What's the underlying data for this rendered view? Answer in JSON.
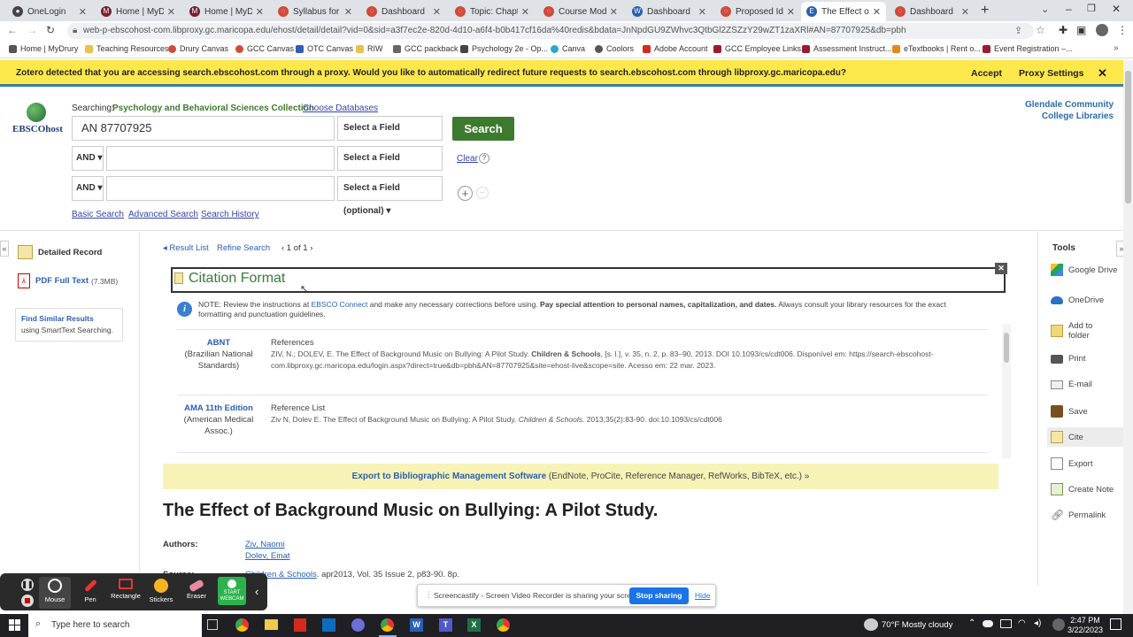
{
  "browser": {
    "tabs": [
      {
        "title": "OneLogin",
        "color": "#444"
      },
      {
        "title": "Home | MyDru",
        "color": "#7a1e2e"
      },
      {
        "title": "Home | MyDru",
        "color": "#7a1e2e"
      },
      {
        "title": "Syllabus for BS",
        "color": "#d04a3a"
      },
      {
        "title": "Dashboard",
        "color": "#d04a3a"
      },
      {
        "title": "Topic: Chapter",
        "color": "#d04a3a"
      },
      {
        "title": "Course Module",
        "color": "#d04a3a"
      },
      {
        "title": "Dashboard",
        "color": "#2b5fb3"
      },
      {
        "title": "Proposed Idea",
        "color": "#d04a3a"
      },
      {
        "title": "The Effect of Ba",
        "color": "#2b5fb3"
      },
      {
        "title": "Dashboard",
        "color": "#d04a3a"
      }
    ],
    "url": "web-p-ebscohost-com.libproxy.gc.maricopa.edu/ehost/detail/detail?vid=0&sid=a3f7ec2e-820d-4d10-a6f4-b0b417cf16da%40redis&bdata=JnNpdGU9ZWhvc3QtbGl2ZSZzY29wZT1zaXRl#AN=87707925&db=pbh",
    "bookmarks": [
      "Home | MyDrury",
      "Teaching Resources",
      "Drury Canvas",
      "GCC Canvas",
      "OTC Canvas",
      "RIW",
      "GCC packback",
      "Psychology 2e - Op...",
      "Canva",
      "Coolors",
      "Adobe Account",
      "GCC Employee Links",
      "Assessment Instruct...",
      "eTextbooks | Rent o...",
      "Event Registration –..."
    ]
  },
  "zotero": {
    "message": "Zotero detected that you are accessing search.ebscohost.com through a proxy. Would you like to automatically redirect future requests to search.ebscohost.com through libproxy.gc.maricopa.edu?",
    "accept": "Accept",
    "settings": "Proxy Settings",
    "close": "✕"
  },
  "search": {
    "searching_label": "Searching:",
    "collection": "Psychology and Behavioral Sciences Collection",
    "choose_db": "Choose Databases",
    "query1": "AN 87707925",
    "field": "Select a Field (optional) ▾",
    "bool": "AND ▾",
    "search_btn": "Search",
    "clear": "Clear",
    "help": "?",
    "basic": "Basic Search",
    "advanced": "Advanced Search",
    "history": "Search History",
    "institution_line1": "Glendale Community",
    "institution_line2": "College Libraries",
    "logo_text": "EBSCOhost"
  },
  "left": {
    "detailed": "Detailed Record",
    "pdf": "PDF Full Text",
    "pdf_size": "(7.3MB)",
    "similar_title": "Find Similar Results",
    "similar_sub": "using SmartText Searching."
  },
  "nav": {
    "result_list": "◂ Result List",
    "refine": "Refine Search",
    "paging": "‹ 1 of 1 ›"
  },
  "citation": {
    "title": "Citation Format",
    "close": "✕",
    "note_prefix": "NOTE: Review the instructions at",
    "note_link": "EBSCO Connect",
    "note_mid": "and make any necessary corrections before using.",
    "note_bold": "Pay special attention to personal names, capitalization, and dates.",
    "note_end": "Always consult your library resources for the exact formatting and punctuation guidelines.",
    "abnt_style": "ABNT",
    "abnt_sub": "(Brazilian National Standards)",
    "abnt_heading": "References",
    "abnt_text_a": "ZIV, N.; DOLEV, E. The Effect of Background Music on Bullying: A Pilot Study.",
    "abnt_text_b": "Children & Schools",
    "abnt_text_c": ", [s. l.], v. 35, n. 2, p. 83–90, 2013. DOI 10.1093/cs/cdt006. Disponível em: https://search-ebscohost-com.libproxy.gc.maricopa.edu/login.aspx?direct=true&db=pbh&AN=87707925&site=ehost-live&scope=site. Acesso em: 22 mar. 2023.",
    "ama_style": "AMA 11th Edition",
    "ama_sub": "(American Medical Assoc.)",
    "ama_heading": "Reference List",
    "ama_text_a": "Ziv N, Dolev E. The Effect of Background Music on Bullying: A Pilot Study.",
    "ama_text_b": "Children & Schools.",
    "ama_text_c": "2013;35(2):83-90. doi:10.1093/cs/cdt006",
    "export_link": "Export to Bibliographic Management Software",
    "export_rest": "(EndNote, ProCite, Reference Manager, RefWorks, BibTeX, etc.) »"
  },
  "record": {
    "title": "The Effect of Background Music on Bullying: A Pilot Study.",
    "authors_label": "Authors:",
    "author1": "Ziv, Naomi",
    "author2": "Dolev, Einat",
    "source_label": "Source:",
    "source_link": "Children & Schools",
    "source_rest": ". apr2013, Vol. 35 Issue 2, p83-90. 8p."
  },
  "tools": {
    "heading": "Tools",
    "items": [
      "Google Drive",
      "OneDrive",
      "Add to folder",
      "Print",
      "E-mail",
      "Save",
      "Cite",
      "Export",
      "Create Note",
      "Permalink"
    ]
  },
  "screencastify": {
    "tools": [
      "Mouse",
      "Pen",
      "Rectangle",
      "Stickers",
      "Eraser",
      "START WEBCAM"
    ],
    "share_msg": "Screencastify - Screen Video Recorder is sharing your screen.",
    "stop": "Stop sharing",
    "hide": "Hide"
  },
  "taskbar": {
    "search": "Type here to search",
    "weather": "70°F  Mostly cloudy",
    "time": "2:47 PM",
    "date": "3/22/2023"
  }
}
